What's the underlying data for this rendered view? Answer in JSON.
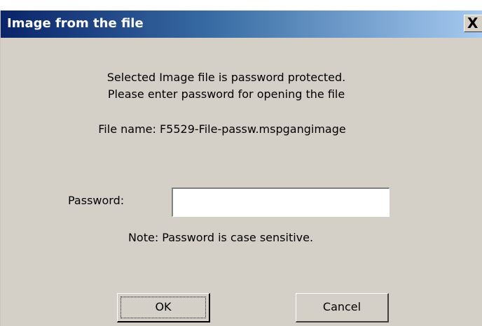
{
  "window": {
    "title": "Image from the file",
    "close_glyph": "X"
  },
  "message": {
    "line1": "Selected Image file is password protected.",
    "line2": "Please enter password for opening the file",
    "file_name": "File name: F5529-File-passw.mspgangimage"
  },
  "password": {
    "label": "Password:",
    "value": "",
    "note": "Note: Password is case sensitive."
  },
  "buttons": {
    "ok": "OK",
    "cancel": "Cancel"
  },
  "icons": {
    "close": "close-icon"
  },
  "colors": {
    "titlebar_start": "#0a246a",
    "titlebar_end": "#a6caf0",
    "dialog_bg": "#d4d0c8"
  }
}
